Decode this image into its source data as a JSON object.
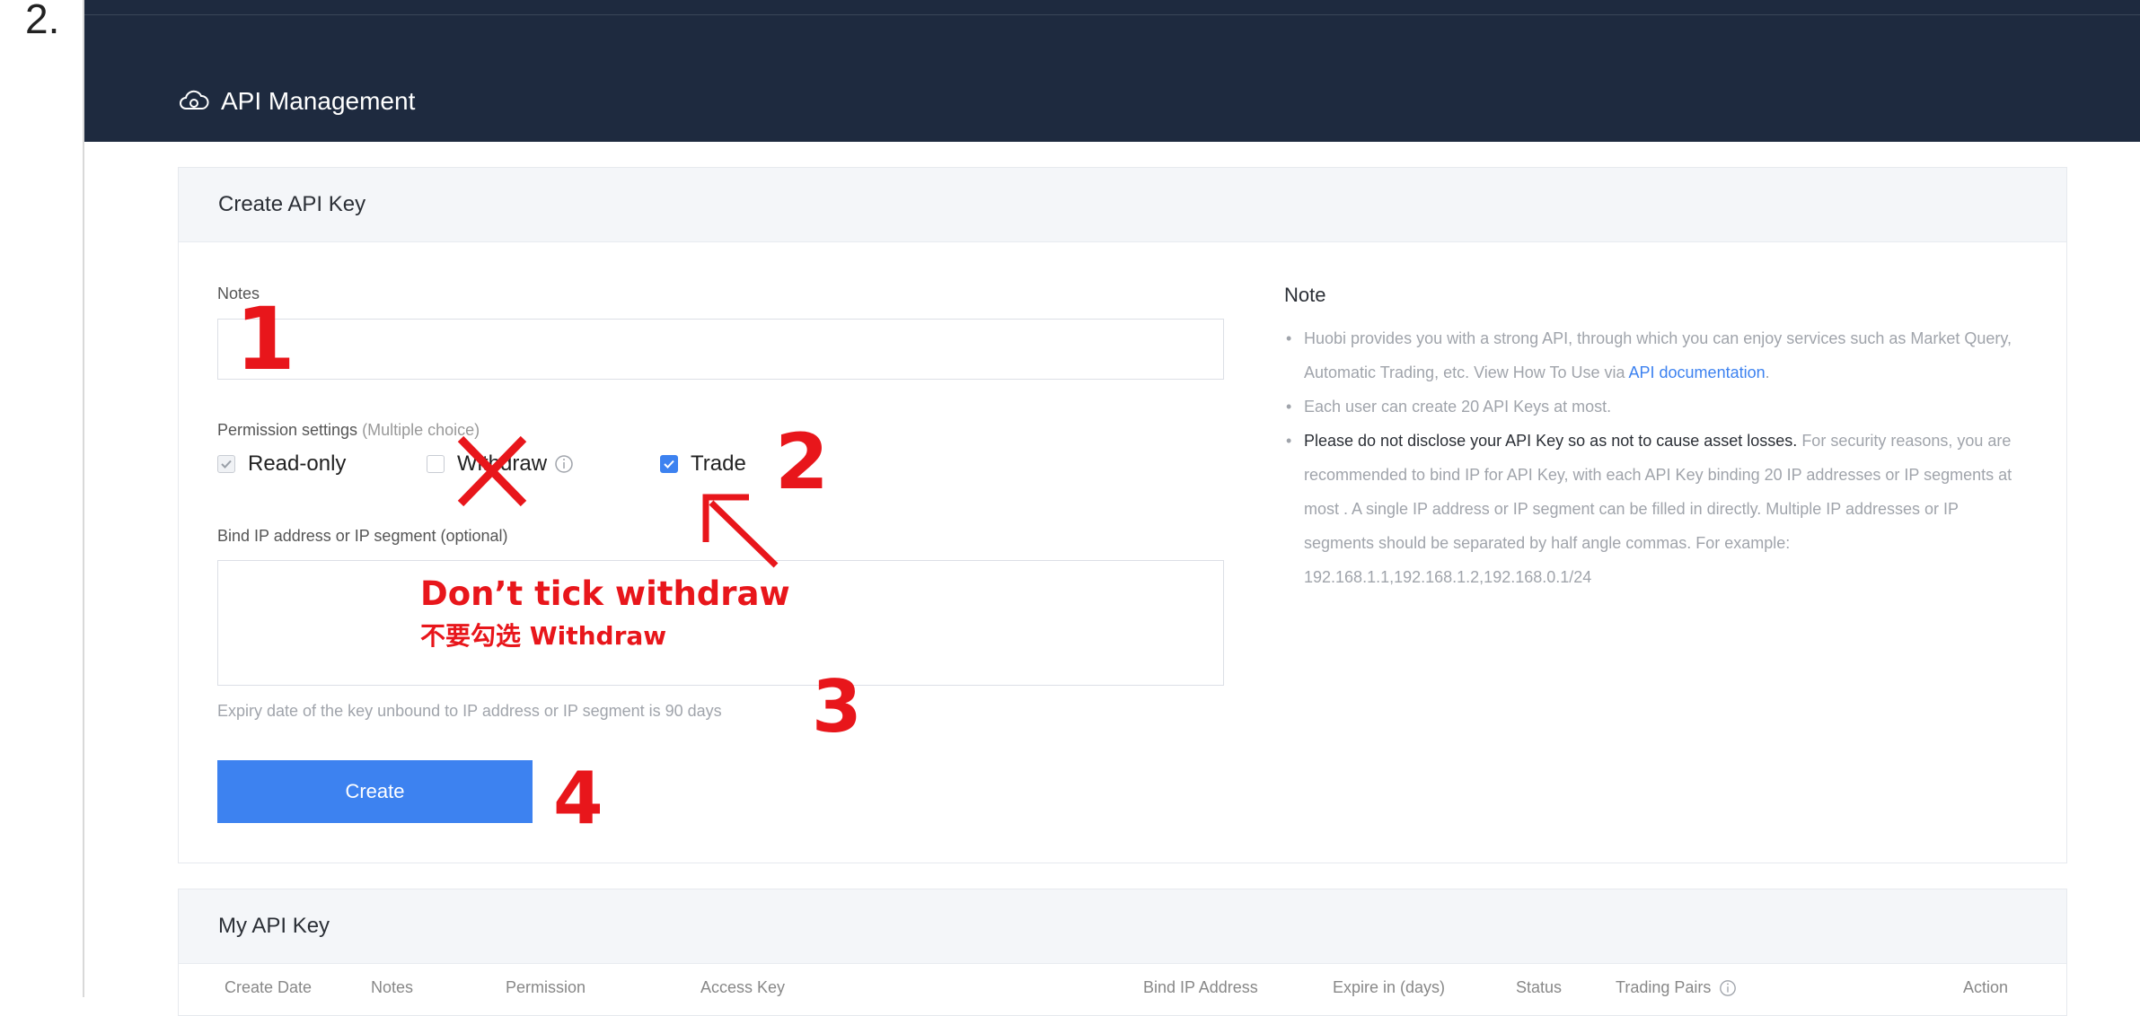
{
  "step_label": "2.",
  "header": {
    "title": "API Management",
    "icon": "cloud-icon"
  },
  "create_card": {
    "title": "Create API Key",
    "notes_label": "Notes",
    "notes_value": "",
    "permission_label": "Permission settings",
    "permission_hint": "(Multiple choice)",
    "permissions": [
      {
        "label": "Read-only",
        "checked": true,
        "disabled": true
      },
      {
        "label": "Withdraw",
        "checked": false,
        "disabled": false
      },
      {
        "label": "Trade",
        "checked": true,
        "disabled": false
      }
    ],
    "ip_label": "Bind IP address or IP segment (optional)",
    "ip_value": "",
    "expiry_text": "Expiry date of the key unbound to IP address or IP segment is 90 days",
    "create_button": "Create"
  },
  "note": {
    "title": "Note",
    "item1_text": "Huobi provides you with a strong API, through which you can enjoy services such as Market Query, Automatic Trading, etc. View How To Use via ",
    "item1_link": "API documentation",
    "item1_end": ".",
    "item2_text": "Each user can create 20 API Keys at most.",
    "item3_strong": "Please do not disclose your API Key so as not to cause asset losses.",
    "item3_text": " For security reasons, you are recommended to bind IP for API Key, with each API Key binding 20 IP addresses or IP segments at most . A single IP address or IP segment can be filled in directly. Multiple IP addresses or IP segments should be separated by half angle commas. For example: 192.168.1.1,192.168.1.2,192.168.0.1/24"
  },
  "api_key_card": {
    "title": "My API Key",
    "columns": [
      "Create Date",
      "Notes",
      "Permission",
      "Access Key",
      "Bind IP Address",
      "Expire in (days)",
      "Status",
      "Trading Pairs",
      "Action"
    ]
  },
  "annotations": {
    "num1": "1",
    "num2": "2",
    "num3": "3",
    "num4": "4",
    "warning_en": "Don’t tick withdraw",
    "warning_zh": "不要勾选 Withdraw",
    "color": "#e8161b"
  },
  "colors": {
    "header_bg": "#1e2a3f",
    "accent": "#3d82f0"
  }
}
